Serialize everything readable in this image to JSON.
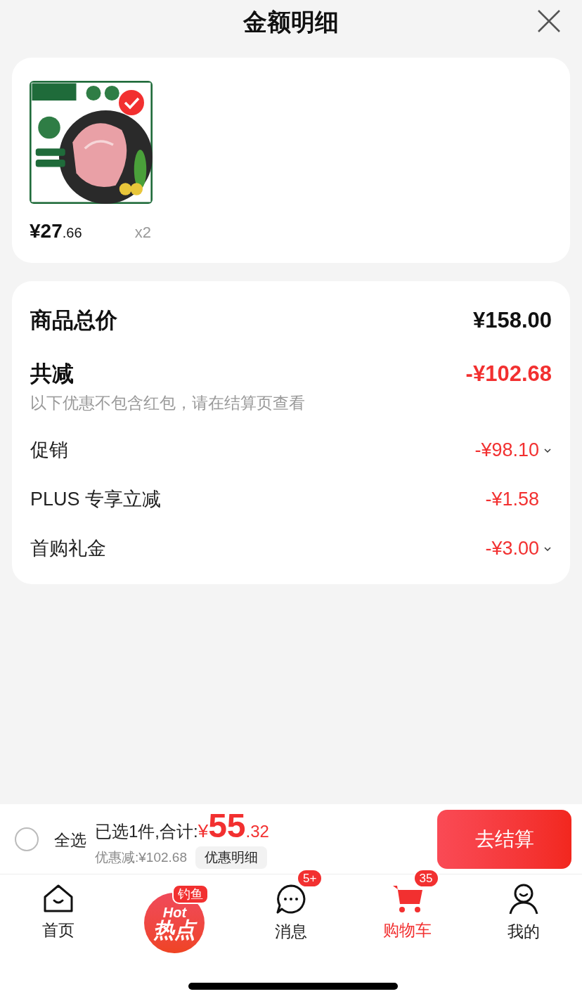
{
  "header": {
    "title": "金额明细"
  },
  "products": [
    {
      "kind": "picture",
      "selected": true,
      "price_main": "¥27",
      "price_cents": ".66",
      "quantity": "x2"
    }
  ],
  "summary": {
    "total_label": "商品总价",
    "total_value": "¥158.00",
    "discount_label": "共减",
    "discount_value": "-¥102.68",
    "note": "以下优惠不包含红包，请在结算页查看",
    "items": [
      {
        "label": "促销",
        "value": "-¥98.10",
        "expandable": true
      },
      {
        "label": "PLUS 专享立减",
        "value": "-¥1.58",
        "expandable": false
      },
      {
        "label": "首购礼金",
        "value": "-¥3.00",
        "expandable": true
      }
    ]
  },
  "checkout_bar": {
    "select_all": {
      "label": "全选",
      "checked": false
    },
    "selected_text": "已选1件,合计:",
    "currency": "¥",
    "total_main": "55",
    "total_cents": ".32",
    "discount_text": "优惠减:¥102.68",
    "detail_button": "优惠明细",
    "checkout_button": "去结算"
  },
  "tab_bar": [
    {
      "kind": "home",
      "label": "首页",
      "selected": false
    },
    {
      "kind": "hot",
      "hot_text": "Hot",
      "hot_title": "热点",
      "badge": "钓鱼",
      "selected": false
    },
    {
      "kind": "message",
      "label": "消息",
      "badge": "5+",
      "selected": false
    },
    {
      "kind": "cart",
      "label": "购物车",
      "badge": "35",
      "selected": true
    },
    {
      "kind": "profile",
      "label": "我的",
      "selected": false
    }
  ]
}
